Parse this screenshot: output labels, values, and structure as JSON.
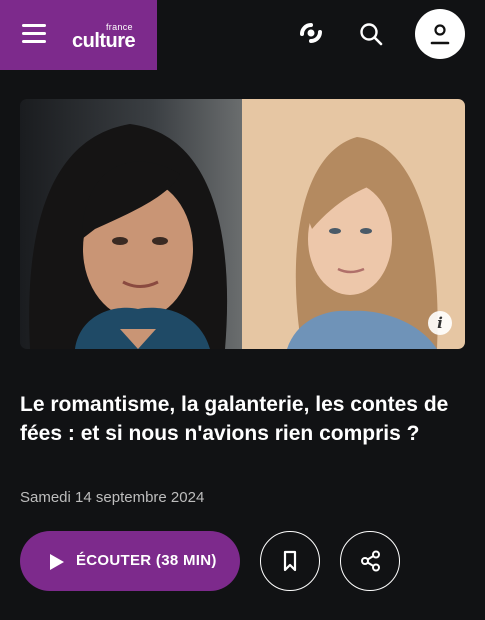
{
  "header": {
    "logo_small": "france",
    "logo_big": "culture",
    "icons": [
      "menu-icon",
      "radio-live-icon",
      "search-icon",
      "user-icon"
    ]
  },
  "episode": {
    "title": "Le romantisme, la galanterie, les contes de fées : et si nous n'avions rien compris ?",
    "date": "Samedi 14 septembre 2024",
    "listen_label": "ÉCOUTER  (38 MIN)",
    "info_glyph": "i"
  },
  "actions": {
    "icons": [
      "play-icon",
      "bookmark-icon",
      "share-icon"
    ]
  },
  "colors": {
    "brand": "#7d2a8c",
    "background": "#111214",
    "date_text": "#bdbdbd"
  }
}
